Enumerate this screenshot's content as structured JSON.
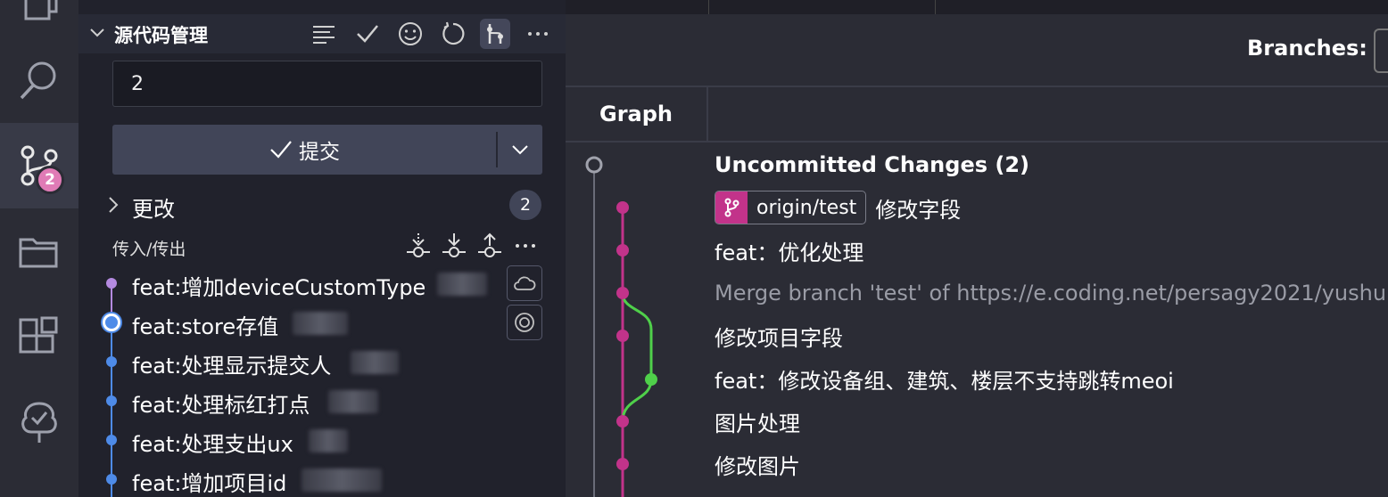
{
  "scm": {
    "title": "源代码管理",
    "message_value": "2",
    "commit_label": "提交",
    "changes_label": "更改",
    "changes_count": "2",
    "incoming_outgoing_label": "传入/传出",
    "activity_badge": "2",
    "commits": [
      {
        "message": "feat:增加deviceCustomType",
        "author": "",
        "dot": "purple"
      },
      {
        "message": "feat:store存值",
        "author": "",
        "dot": "current"
      },
      {
        "message": "feat:处理显示提交人",
        "author": "",
        "dot": "blue"
      },
      {
        "message": "feat:处理标红打点",
        "author": "",
        "dot": "blue"
      },
      {
        "message": "feat:处理支出ux",
        "author": "",
        "dot": "blue"
      },
      {
        "message": "feat:增加项目id",
        "author": "",
        "dot": "blue"
      }
    ]
  },
  "graph_view": {
    "branches_label": "Branches:",
    "graph_column": "Graph",
    "rows": [
      {
        "text": "Uncommitted Changes (2)",
        "style": "bold"
      },
      {
        "text": "修改字段",
        "branch": "origin/test"
      },
      {
        "text": "feat：优化处理"
      },
      {
        "text": "Merge branch 'test' of https://e.coding.net/persagy2021/yushu",
        "style": "muted"
      },
      {
        "text": "修改项目字段"
      },
      {
        "text": "feat：修改设备组、建筑、楼层不支持跳转meoi"
      },
      {
        "text": "图片处理"
      },
      {
        "text": "修改图片"
      }
    ]
  },
  "colors": {
    "graph_main": "#c2338a",
    "graph_merge": "#4fd04a",
    "commit_dot": "#4e8be8",
    "badge": "#e07bb6"
  },
  "icons": {
    "activity": [
      "copy-icon",
      "search-icon",
      "source-control-icon",
      "folder-icon",
      "extensions-icon",
      "tree-check-icon"
    ],
    "scm_toolbar": [
      "view-as-tree-icon",
      "check-icon",
      "emoji-icon",
      "refresh-icon",
      "graph-icon",
      "more-icon"
    ],
    "io_toolbar": [
      "fetch-icon",
      "pull-icon",
      "push-icon",
      "more-icon"
    ]
  }
}
